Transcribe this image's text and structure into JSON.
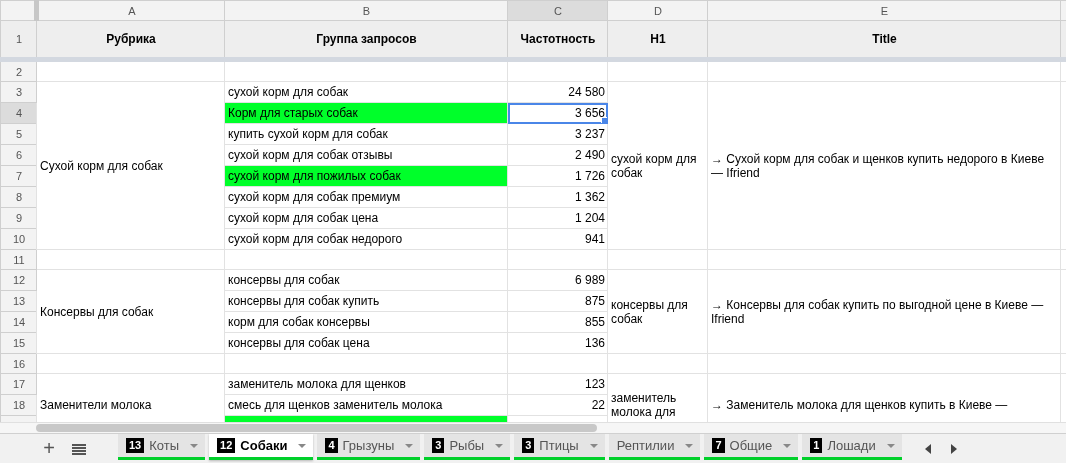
{
  "column_headers": [
    {
      "label": "A",
      "selected": false
    },
    {
      "label": "B",
      "selected": false
    },
    {
      "label": "C",
      "selected": true
    },
    {
      "label": "D",
      "selected": false
    },
    {
      "label": "E",
      "selected": false
    }
  ],
  "header_row": {
    "number": "1",
    "cells": [
      "Рубрика",
      "Группа запросов",
      "Частотность",
      "H1",
      "Title"
    ]
  },
  "sections": [
    {
      "kind": "spacer",
      "number": "2"
    },
    {
      "kind": "group",
      "rubric": "Сухой корм для собак",
      "h1": "сухой корм для собак",
      "title": "→ Сухой корм для собак и щенков купить недорого в Киеве — Ifriend",
      "rows": [
        {
          "number": "3",
          "query": "сухой корм для собак",
          "frequency": "24 580",
          "highlighted": false,
          "selected": false
        },
        {
          "number": "4",
          "query": "Корм для старых собак",
          "frequency": "3 656",
          "highlighted": true,
          "selected": true
        },
        {
          "number": "5",
          "query": "купить сухой корм для собак",
          "frequency": "3 237",
          "highlighted": false,
          "selected": false
        },
        {
          "number": "6",
          "query": "сухой корм для собак отзывы",
          "frequency": "2 490",
          "highlighted": false,
          "selected": false
        },
        {
          "number": "7",
          "query": "сухой корм для пожилых собак",
          "frequency": "1 726",
          "highlighted": true,
          "selected": false
        },
        {
          "number": "8",
          "query": "сухой корм для собак премиум",
          "frequency": "1 362",
          "highlighted": false,
          "selected": false
        },
        {
          "number": "9",
          "query": "сухой корм для собак цена",
          "frequency": "1 204",
          "highlighted": false,
          "selected": false
        },
        {
          "number": "10",
          "query": "сухой корм для собак недорого",
          "frequency": "941",
          "highlighted": false,
          "selected": false
        }
      ]
    },
    {
      "kind": "spacer",
      "number": "11"
    },
    {
      "kind": "group",
      "rubric": "Консервы для собак",
      "h1": "консервы для собак",
      "title": "→ Консервы для собак купить по выгодной цене в Киеве — Ifriend",
      "rows": [
        {
          "number": "12",
          "query": "консервы для собак",
          "frequency": "6 989",
          "highlighted": false,
          "selected": false
        },
        {
          "number": "13",
          "query": "консервы для собак купить",
          "frequency": "875",
          "highlighted": false,
          "selected": false
        },
        {
          "number": "14",
          "query": "корм для собак консервы",
          "frequency": "855",
          "highlighted": false,
          "selected": false
        },
        {
          "number": "15",
          "query": "консервы для собак цена",
          "frequency": "136",
          "highlighted": false,
          "selected": false
        }
      ]
    },
    {
      "kind": "spacer",
      "number": "16"
    },
    {
      "kind": "group",
      "rubric": "Заменители молока",
      "h1": "заменитель молока для",
      "title": "→ Заменитель молока для щенков купить в Киеве —",
      "rows": [
        {
          "number": "17",
          "query": "заменитель молока для щенков",
          "frequency": "123",
          "highlighted": false,
          "selected": false
        },
        {
          "number": "18",
          "query": "смесь для щенков заменитель молока",
          "frequency": "22",
          "highlighted": false,
          "selected": false
        },
        {
          "highlighted": true,
          "selected": false
        }
      ]
    }
  ],
  "add_button": "+",
  "tabs": [
    {
      "count": "13",
      "label": "Коты",
      "selected": false
    },
    {
      "count": "12",
      "label": "Собаки",
      "selected": true
    },
    {
      "count": "4",
      "label": "Грызуны",
      "selected": false
    },
    {
      "count": "3",
      "label": "Рыбы",
      "selected": false
    },
    {
      "count": "3",
      "label": "Птицы",
      "selected": false
    },
    {
      "label": "Рептилии",
      "selected": false
    },
    {
      "count": "7",
      "label": "Общие",
      "selected": false
    },
    {
      "count": "1",
      "label": "Лошади",
      "selected": false
    }
  ]
}
